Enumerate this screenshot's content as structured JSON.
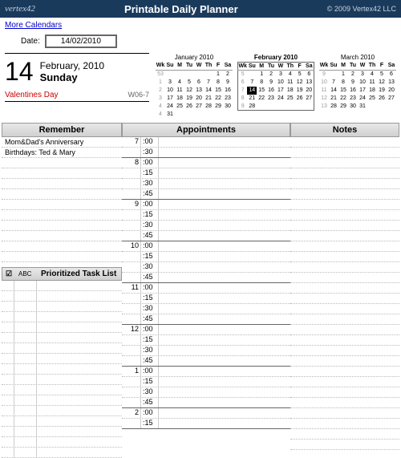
{
  "header": {
    "logo": "vertex42",
    "title": "Printable Daily Planner",
    "copyright": "© 2009 Vertex42 LLC"
  },
  "topbar": {
    "more_link": "More Calendars",
    "date_label": "Date:",
    "date_value": "14/02/2010"
  },
  "day": {
    "num": "14",
    "month_year": "February, 2010",
    "weekday": "Sunday",
    "holiday": "Valentines Day",
    "week": "W06-7"
  },
  "minicals": [
    {
      "title": "January 2010",
      "bold": false,
      "head": [
        "Wk",
        "Su",
        "M",
        "Tu",
        "W",
        "Th",
        "F",
        "Sa"
      ],
      "rows": [
        [
          "53",
          "",
          "",
          "",
          "",
          "",
          "1",
          "2"
        ],
        [
          "1",
          "3",
          "4",
          "5",
          "6",
          "7",
          "8",
          "9"
        ],
        [
          "2",
          "10",
          "11",
          "12",
          "13",
          "14",
          "15",
          "16"
        ],
        [
          "3",
          "17",
          "18",
          "19",
          "20",
          "21",
          "22",
          "23"
        ],
        [
          "4",
          "24",
          "25",
          "26",
          "27",
          "28",
          "29",
          "30"
        ],
        [
          "4",
          "31",
          "",
          "",
          "",
          "",
          "",
          ""
        ]
      ],
      "hl": []
    },
    {
      "title": "February 2010",
      "bold": true,
      "head": [
        "Wk",
        "Su",
        "M",
        "Tu",
        "W",
        "Th",
        "F",
        "Sa"
      ],
      "rows": [
        [
          "5",
          "",
          "1",
          "2",
          "3",
          "4",
          "5",
          "6"
        ],
        [
          "6",
          "7",
          "8",
          "9",
          "10",
          "11",
          "12",
          "13"
        ],
        [
          "7",
          "14",
          "15",
          "16",
          "17",
          "18",
          "19",
          "20"
        ],
        [
          "8",
          "21",
          "22",
          "23",
          "24",
          "25",
          "26",
          "27"
        ],
        [
          "9",
          "28",
          "",
          "",
          "",
          "",
          "",
          ""
        ]
      ],
      "hl": [
        [
          2,
          1
        ]
      ]
    },
    {
      "title": "March 2010",
      "bold": false,
      "head": [
        "Wk",
        "Su",
        "M",
        "Tu",
        "W",
        "Th",
        "F",
        "Sa"
      ],
      "rows": [
        [
          "9",
          "",
          "1",
          "2",
          "3",
          "4",
          "5",
          "6"
        ],
        [
          "10",
          "7",
          "8",
          "9",
          "10",
          "11",
          "12",
          "13"
        ],
        [
          "11",
          "14",
          "15",
          "16",
          "17",
          "18",
          "19",
          "20"
        ],
        [
          "12",
          "21",
          "22",
          "23",
          "24",
          "25",
          "26",
          "27"
        ],
        [
          "13",
          "28",
          "29",
          "30",
          "31",
          "",
          "",
          ""
        ]
      ],
      "hl": []
    }
  ],
  "sections": {
    "remember": "Remember",
    "appointments": "Appointments",
    "notes": "Notes",
    "task_check": "☑",
    "task_abc": "ABC",
    "task_title": "Prioritized Task List"
  },
  "remember_items": [
    "Mom&Dad's Anniversary",
    "Birthdays: Ted & Mary"
  ],
  "appointments": [
    {
      "h": "7",
      "slots": [
        ":00",
        ":30"
      ]
    },
    {
      "h": "8",
      "slots": [
        ":00",
        ":15",
        ":30",
        ":45"
      ]
    },
    {
      "h": "9",
      "slots": [
        ":00",
        ":15",
        ":30",
        ":45"
      ]
    },
    {
      "h": "10",
      "slots": [
        ":00",
        ":15",
        ":30",
        ":45"
      ]
    },
    {
      "h": "11",
      "slots": [
        ":00",
        ":15",
        ":30",
        ":45"
      ]
    },
    {
      "h": "12",
      "slots": [
        ":00",
        ":15",
        ":30",
        ":45"
      ]
    },
    {
      "h": "1",
      "slots": [
        ":00",
        ":15",
        ":30",
        ":45"
      ]
    },
    {
      "h": "2",
      "slots": [
        ":00",
        ":15"
      ]
    }
  ]
}
